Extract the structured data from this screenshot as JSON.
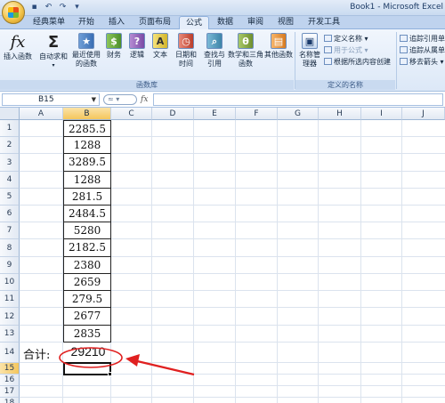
{
  "window": {
    "title": "Book1 - Microsoft Excel"
  },
  "tabs": [
    {
      "label": "经典菜单"
    },
    {
      "label": "开始"
    },
    {
      "label": "插入"
    },
    {
      "label": "页面布局"
    },
    {
      "label": "公式"
    },
    {
      "label": "数据"
    },
    {
      "label": "审阅"
    },
    {
      "label": "视图"
    },
    {
      "label": "开发工具"
    }
  ],
  "ribbon": {
    "function_library": {
      "insert_function": "插入函数",
      "autosum": "自动求和",
      "recent": "最近使用的函数",
      "financial": "财务",
      "logical": "逻辑",
      "text": "文本",
      "datetime": "日期和时间",
      "lookup": "查找与引用",
      "math": "数学和三角函数",
      "more": "其他函数",
      "group_label": "函数库"
    },
    "defined_names": {
      "name_manager": "名称管理器",
      "define_name": "定义名称",
      "use_in_formula": "用于公式",
      "create_from_selection": "根据所选内容创建",
      "group_label": "定义的名称"
    },
    "auditing": {
      "trace_precedents": "追踪引用单",
      "trace_dependents": "追踪从属单",
      "remove_arrows": "移去箭头"
    }
  },
  "formula_bar": {
    "name_box": "B15",
    "formula": ""
  },
  "sheet": {
    "columns": [
      "A",
      "B",
      "C",
      "D",
      "E",
      "F",
      "G",
      "H",
      "I",
      "J"
    ],
    "rows": [
      "1",
      "2",
      "3",
      "4",
      "5",
      "6",
      "7",
      "8",
      "9",
      "10",
      "11",
      "12",
      "13",
      "14",
      "15",
      "16",
      "17",
      "18"
    ],
    "values_b": [
      "2285.5",
      "1288",
      "3289.5",
      "1288",
      "281.5",
      "2484.5",
      "5280",
      "2182.5",
      "2380",
      "2659",
      "279.5",
      "2677",
      "2835"
    ],
    "total_label": "合计:",
    "total_value": "29210",
    "active_cell": "B15"
  },
  "annotation": {
    "circle_color": "#e02020",
    "arrow_color": "#e02020"
  }
}
